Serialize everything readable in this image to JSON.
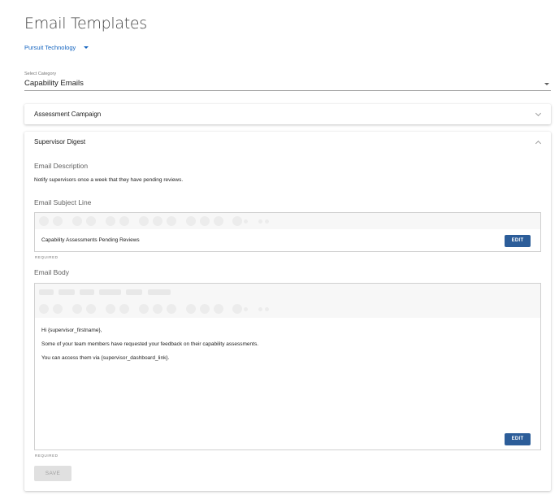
{
  "page": {
    "title": "Email Templates"
  },
  "organization": {
    "selected": "Pursuit Technology"
  },
  "category": {
    "caption": "Select Category",
    "selected": "Capability Emails"
  },
  "panels": [
    {
      "title": "Assessment Campaign",
      "expanded": false
    },
    {
      "title": "Supervisor Digest",
      "expanded": true
    }
  ],
  "template": {
    "description_heading": "Email Description",
    "description_text": "Notify supervisors once a week that they have pending reviews.",
    "subject_heading": "Email Subject Line",
    "subject_value": "Capability Assessments Pending Reviews",
    "subject_required": "REQUIRED",
    "body_heading": "Email Body",
    "body_lines": [
      "Hi {supervisor_firstname},",
      "Some of your team members have requested your feedback on their capability assessments.",
      "You can access them via {supervisor_dashboard_link}."
    ],
    "body_required": "REQUIRED",
    "edit_label": "EDIT",
    "save_label": "SAVE"
  },
  "colors": {
    "accent": "#1565c0",
    "button": "#2c5d99",
    "disabled": "#e0e0e0"
  }
}
